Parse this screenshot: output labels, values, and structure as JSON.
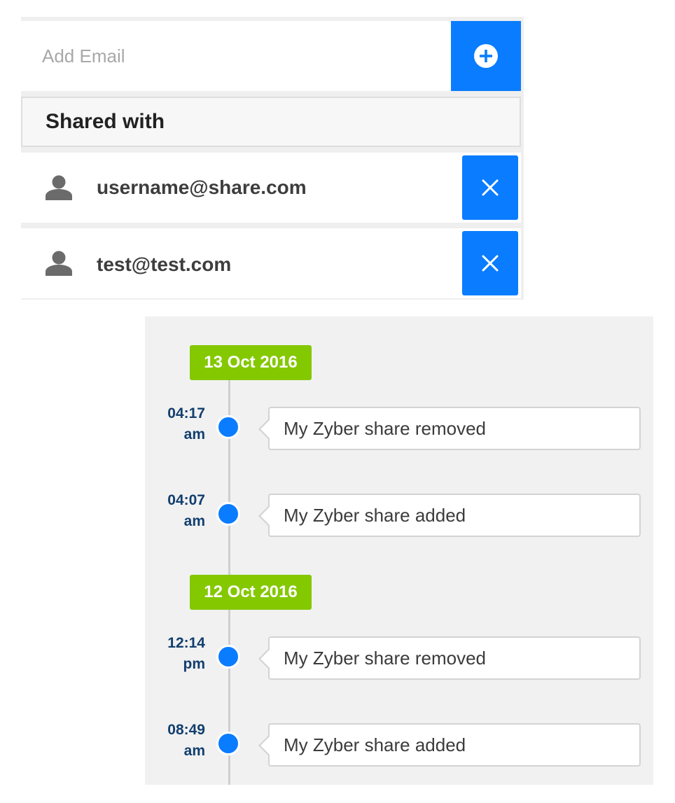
{
  "share": {
    "add_email_placeholder": "Add Email",
    "add_icon": "plus-circle-icon",
    "shared_with_label": "Shared with",
    "users": [
      {
        "email": "username@share.com",
        "icon": "user-icon",
        "remove_icon": "close-icon"
      },
      {
        "email": "test@test.com",
        "icon": "user-icon",
        "remove_icon": "close-icon"
      }
    ]
  },
  "timeline": {
    "groups": [
      {
        "date": "13 Oct 2016",
        "events": [
          {
            "time": "04:17",
            "period": "am",
            "text": "My Zyber share removed"
          },
          {
            "time": "04:07",
            "period": "am",
            "text": "My Zyber share added"
          }
        ]
      },
      {
        "date": "12 Oct 2016",
        "events": [
          {
            "time": "12:14",
            "period": "pm",
            "text": "My Zyber share removed"
          },
          {
            "time": "08:49",
            "period": "am",
            "text": "My Zyber share added"
          }
        ]
      }
    ]
  },
  "colors": {
    "accent_blue": "#0a7cff",
    "date_green": "#84c800",
    "time_navy": "#123f6e"
  }
}
